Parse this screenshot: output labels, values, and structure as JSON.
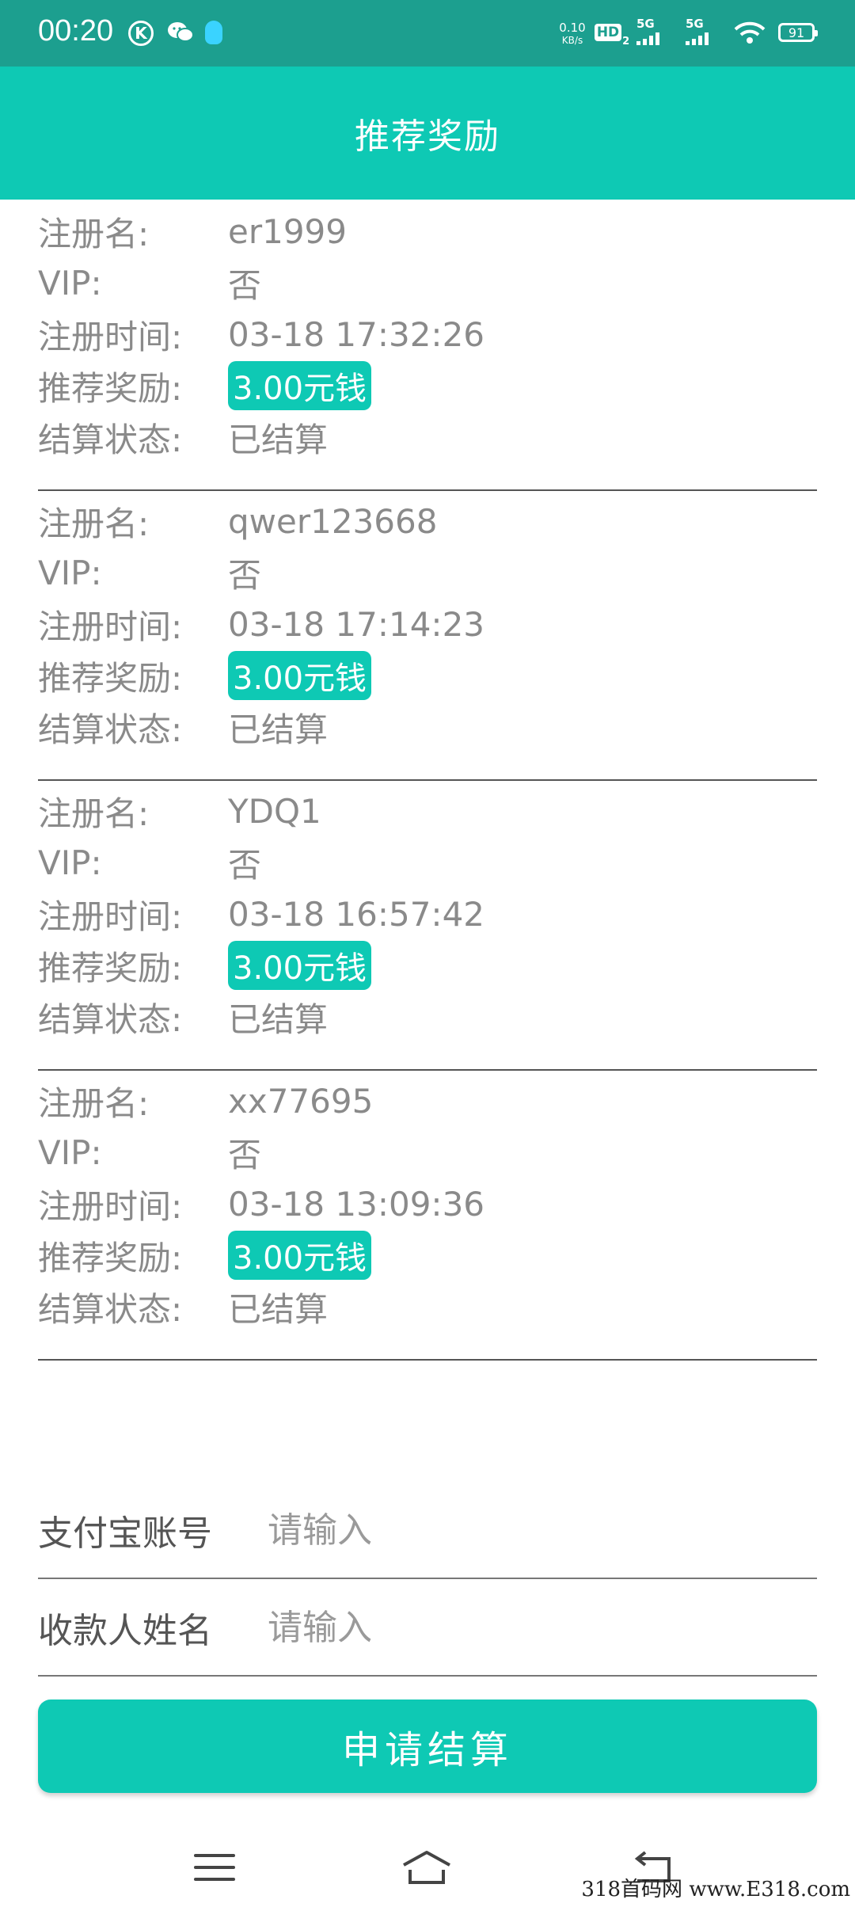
{
  "status_bar": {
    "time": "00:20",
    "k_badge": "K",
    "net_speed_value": "0.10",
    "net_speed_unit": "KB/s",
    "hd": "HD",
    "hd_sub": "2",
    "signal_1": "5G",
    "signal_2": "5G",
    "battery": "91"
  },
  "header": {
    "title": "推荐奖励"
  },
  "labels": {
    "name": "注册名:",
    "vip": "VIP:",
    "time": "注册时间:",
    "reward": "推荐奖励:",
    "status": "结算状态:"
  },
  "records": [
    {
      "name": "er1999",
      "vip": "否",
      "time": "03-18  17:32:26",
      "reward": "3.00元钱",
      "status": "已结算"
    },
    {
      "name": "qwer123668",
      "vip": "否",
      "time": "03-18  17:14:23",
      "reward": "3.00元钱",
      "status": "已结算"
    },
    {
      "name": "YDQ1",
      "vip": "否",
      "time": "03-18  16:57:42",
      "reward": "3.00元钱",
      "status": "已结算"
    },
    {
      "name": "xx77695",
      "vip": "否",
      "time": "03-18  13:09:36",
      "reward": "3.00元钱",
      "status": "已结算"
    }
  ],
  "form": {
    "alipay_label": "支付宝账号",
    "alipay_placeholder": "请输入",
    "payee_label": "收款人姓名",
    "payee_placeholder": "请输入"
  },
  "submit_label": "申请结算",
  "watermark": "318首码网  www.E318.com"
}
